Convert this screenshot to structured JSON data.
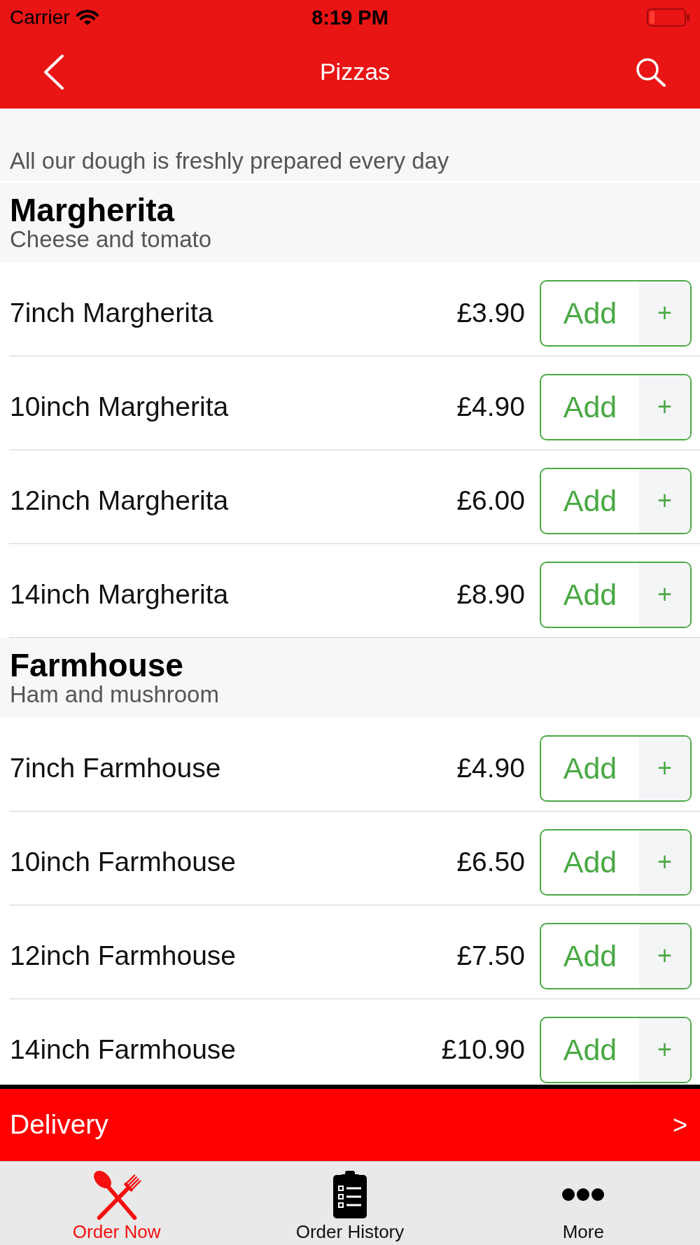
{
  "status_bar": {
    "carrier": "Carrier",
    "time": "8:19 PM"
  },
  "nav_bar": {
    "title": "Pizzas"
  },
  "notice": "All our dough is freshly prepared every day",
  "sections": [
    {
      "title": "Margherita",
      "subtitle": "Cheese and tomato",
      "items": [
        {
          "name": "7inch Margherita",
          "price": "£3.90",
          "button": "Add",
          "plus": "+"
        },
        {
          "name": "10inch Margherita",
          "price": "£4.90",
          "button": "Add",
          "plus": "+"
        },
        {
          "name": "12inch Margherita",
          "price": "£6.00",
          "button": "Add",
          "plus": "+"
        },
        {
          "name": "14inch Margherita",
          "price": "£8.90",
          "button": "Add",
          "plus": "+"
        }
      ]
    },
    {
      "title": "Farmhouse",
      "subtitle": "Ham and mushroom",
      "items": [
        {
          "name": "7inch Farmhouse",
          "price": "£4.90",
          "button": "Add",
          "plus": "+"
        },
        {
          "name": "10inch Farmhouse",
          "price": "£6.50",
          "button": "Add",
          "plus": "+"
        },
        {
          "name": "12inch Farmhouse",
          "price": "£7.50",
          "button": "Add",
          "plus": "+"
        },
        {
          "name": "14inch Farmhouse",
          "price": "£10.90",
          "button": "Add",
          "plus": "+"
        }
      ]
    }
  ],
  "delivery_bar": {
    "label": "Delivery",
    "arrow": ">"
  },
  "tab_bar": [
    {
      "label": "Order Now",
      "selected": true
    },
    {
      "label": "Order History",
      "selected": false
    },
    {
      "label": "More",
      "selected": false
    }
  ]
}
